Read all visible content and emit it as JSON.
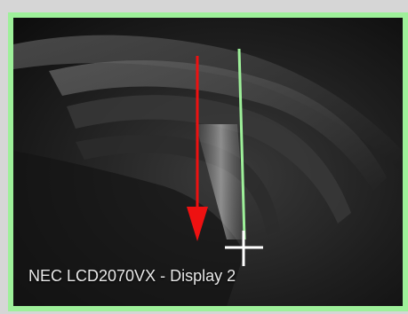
{
  "display": {
    "name": "NEC LCD2070VX - Display 2",
    "selected": true,
    "accent_color": "#9ef09a"
  },
  "overlays": {
    "arrow_color": "#ee1111",
    "arrow_icon": "red-down-arrow",
    "cursor_icon": "crosshair-cursor",
    "guide_line_color": "#9ef09a"
  }
}
